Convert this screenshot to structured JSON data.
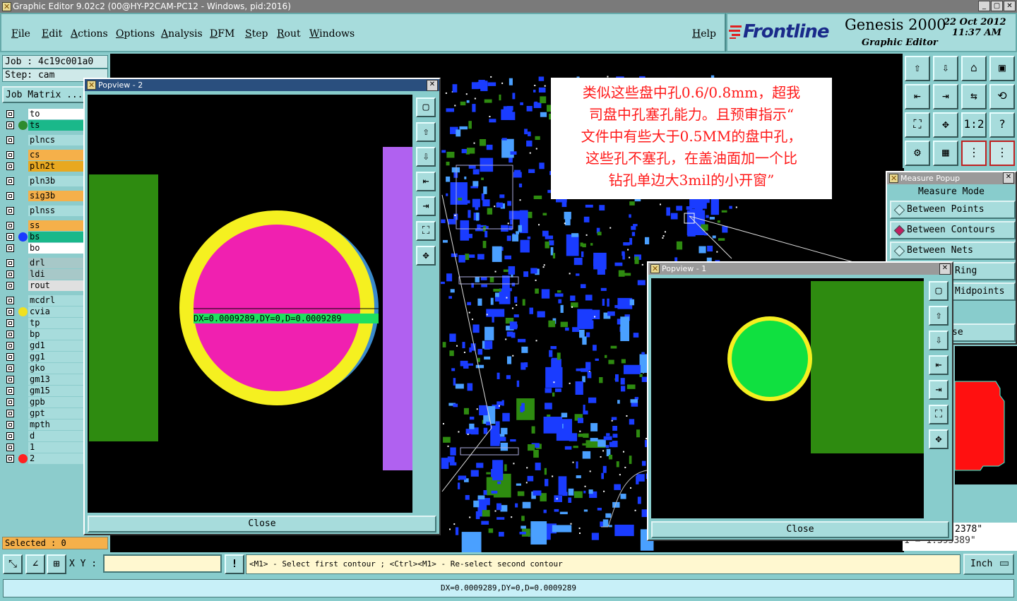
{
  "window": {
    "title": "Graphic Editor 9.02c2 (00@HY-P2CAM-PC12 - Windows, pid:2016)",
    "min": "_",
    "max": "▢",
    "close": "✕"
  },
  "menu": {
    "items": [
      "File",
      "Edit",
      "Actions",
      "Options",
      "Analysis",
      "DFM",
      "Step",
      "Rout",
      "Windows"
    ],
    "help": "Help"
  },
  "branding": {
    "logo": "Frontline",
    "product": "Genesis 2000",
    "subtitle": "Graphic Editor",
    "date": "22 Oct 2012",
    "time": "11:37 AM"
  },
  "left_panel": {
    "job": "Job : 4c19c001a0",
    "step": "Step: cam",
    "job_matrix": "Job Matrix ...",
    "selected": "Selected : 0",
    "layers": [
      {
        "name": "to",
        "color": "#ffffff",
        "dot": ""
      },
      {
        "name": "ts",
        "color": "#1ab88a",
        "dot": "#2e8b2e"
      },
      {
        "name": "plncs",
        "color": "#a7dcdc",
        "dot": ""
      },
      {
        "name": "cs",
        "color": "#f5b04a",
        "dot": ""
      },
      {
        "name": "pln2t",
        "color": "#e8a820",
        "dot": ""
      },
      {
        "name": "pln3b",
        "color": "#a7dcdc",
        "dot": ""
      },
      {
        "name": "sig3b",
        "color": "#f5b04a",
        "dot": ""
      },
      {
        "name": "plnss",
        "color": "#a7dcdc",
        "dot": ""
      },
      {
        "name": "ss",
        "color": "#f5b04a",
        "dot": ""
      },
      {
        "name": "bs",
        "color": "#1ab88a",
        "dot": "#1a3cff"
      },
      {
        "name": "bo",
        "color": "#ffffff",
        "dot": ""
      },
      {
        "name": "drl",
        "color": "#a7c8c8",
        "dot": ""
      },
      {
        "name": "ldi",
        "color": "#a7c8c8",
        "dot": ""
      },
      {
        "name": "rout",
        "color": "#e0e0e0",
        "dot": ""
      },
      {
        "name": "mcdrl",
        "color": "#a7dcdc",
        "dot": ""
      },
      {
        "name": "cvia",
        "color": "#a7dcdc",
        "dot": "#f0e020"
      },
      {
        "name": "tp",
        "color": "#a7dcdc",
        "dot": ""
      },
      {
        "name": "bp",
        "color": "#a7dcdc",
        "dot": ""
      },
      {
        "name": "gd1",
        "color": "#a7dcdc",
        "dot": ""
      },
      {
        "name": "gg1",
        "color": "#a7dcdc",
        "dot": ""
      },
      {
        "name": "gko",
        "color": "#a7dcdc",
        "dot": ""
      },
      {
        "name": "gm13",
        "color": "#a7dcdc",
        "dot": ""
      },
      {
        "name": "gm15",
        "color": "#a7dcdc",
        "dot": ""
      },
      {
        "name": "gpb",
        "color": "#a7dcdc",
        "dot": ""
      },
      {
        "name": "gpt",
        "color": "#a7dcdc",
        "dot": ""
      },
      {
        "name": "mpth",
        "color": "#a7dcdc",
        "dot": ""
      },
      {
        "name": "d",
        "color": "#a7dcdc",
        "dot": ""
      },
      {
        "name": "1",
        "color": "#a7dcdc",
        "dot": ""
      },
      {
        "name": "2",
        "color": "#a7dcdc",
        "dot": "#ff2020"
      }
    ]
  },
  "popview2": {
    "title": "Popview - 2",
    "measure": "DX=0.0009289,DY=0,D=0.0009289",
    "close": "Close"
  },
  "popview1": {
    "title": "Popview - 1",
    "close": "Close"
  },
  "annotation": {
    "lines": [
      "类似这些盘中孔0.6/0.8mm，超我",
      "司盘中孔塞孔能力。且预审指示“",
      "文件中有些大于0.5MM的盘中孔，",
      "这些孔不塞孔，在盖油面加一个比",
      "钻孔单边大3mil的小开窗”"
    ]
  },
  "measure_popup": {
    "title": "Measure Popup",
    "header": "Measure Mode",
    "modes": [
      "Between Points",
      "Between Contours",
      "Between Nets",
      "Ring",
      "Midpoints"
    ],
    "selected_index": 1,
    "close_partial": "se"
  },
  "readouts": {
    "line1": "2378\"",
    "line2": "1 = 1.395389\""
  },
  "bottom": {
    "xy_label": "X Y :",
    "xy_value": "",
    "warn": "!",
    "prompt": "<M1> - Select first contour ; <Ctrl><M1> - Re-select second contour",
    "unit": "Inch"
  },
  "status": {
    "text": "DX=0.0009289,DY=0,D=0.0009289"
  },
  "tool_icons": [
    "zoom-home-icon",
    "zoom-to-icon",
    "home-icon",
    "window-icon",
    "pan-left-icon",
    "pan-right-icon",
    "mirror-icon",
    "rotate-icon",
    "fit-icon",
    "center-icon",
    "scale-icon",
    "help-icon",
    "tool-icon",
    "grid-icon",
    "snap-icon",
    "snap-net-icon"
  ]
}
